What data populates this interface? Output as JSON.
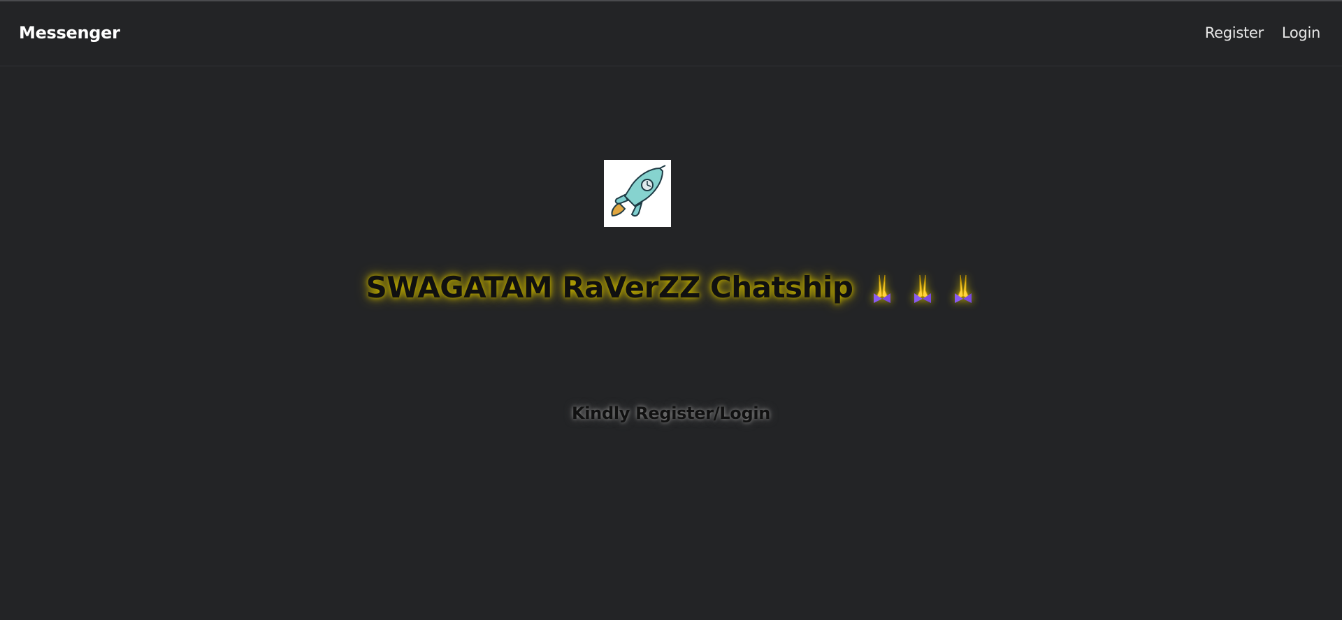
{
  "navbar": {
    "brand": "Messenger",
    "links": [
      {
        "label": "Register"
      },
      {
        "label": "Login"
      }
    ]
  },
  "hero": {
    "logo_icon": "rocket-icon",
    "title": "SWAGATAM RaVerZZ Chatship",
    "emojis": [
      "folded-hands-icon",
      "folded-hands-icon",
      "folded-hands-icon"
    ],
    "subtitle": "Kindly Register/Login"
  },
  "colors": {
    "background": "#232426",
    "title_glow": "#c8b400",
    "brand_text": "#ffffff"
  }
}
